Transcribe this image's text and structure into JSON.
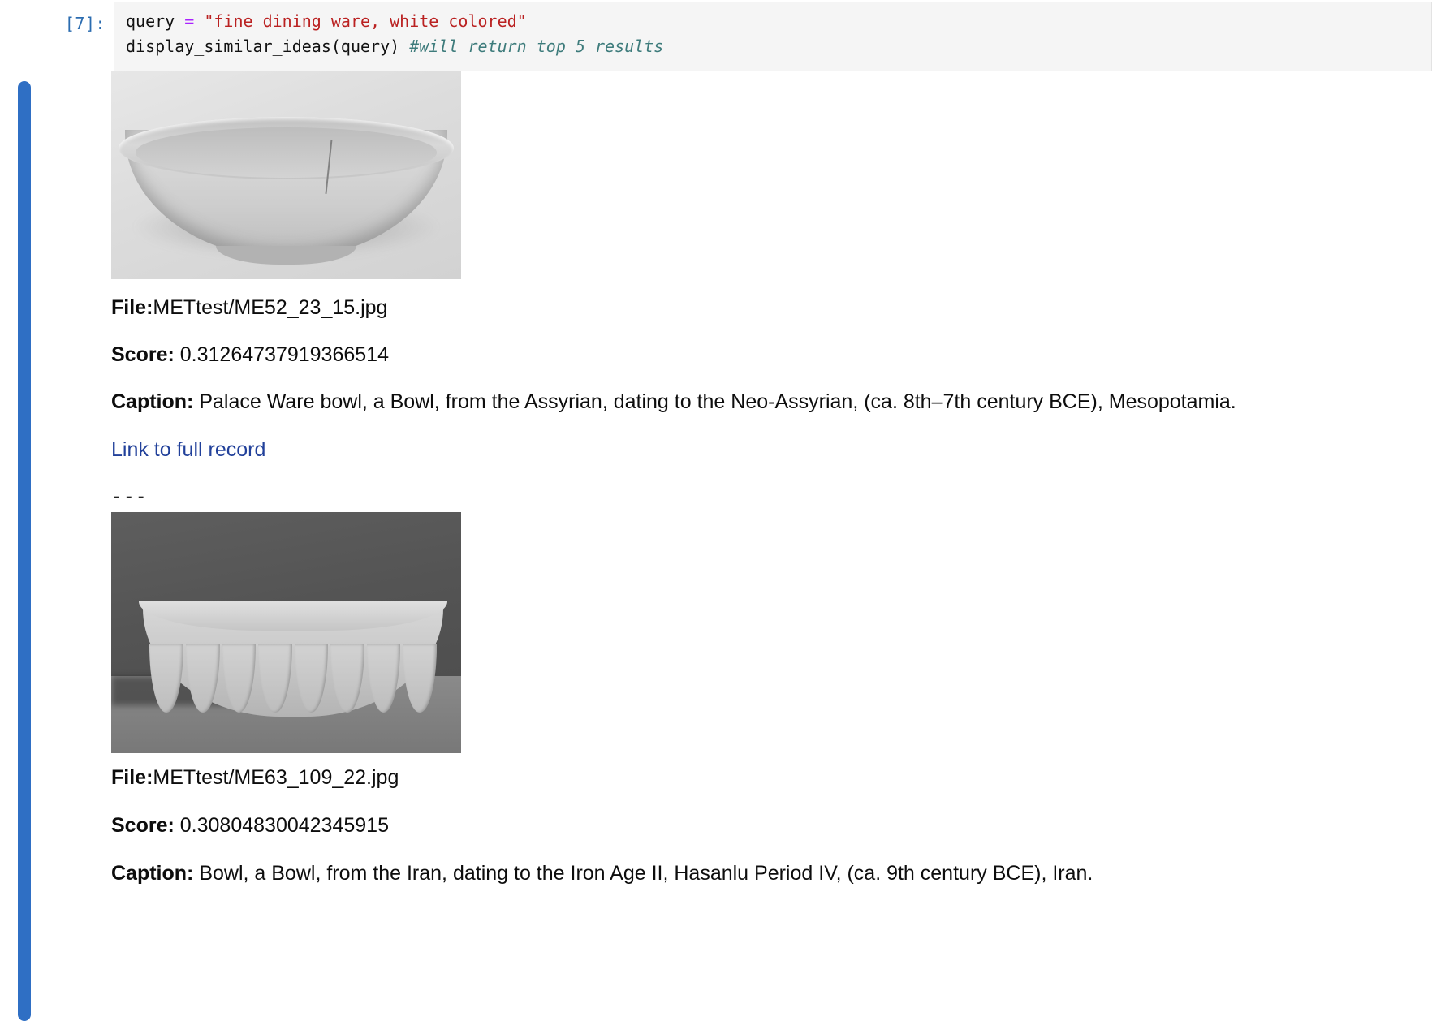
{
  "cell": {
    "prompt": "[7]:",
    "code": {
      "line1": {
        "var": "query ",
        "op": "=",
        "string": " \"fine dining ware, white colored\""
      },
      "line2": {
        "call": "display_similar_ideas(query) ",
        "comment": "#will return top 5 results"
      }
    }
  },
  "output": {
    "labels": {
      "file": "File:",
      "score": "Score:",
      "caption": "Caption:"
    },
    "separator": "---",
    "link_text": "Link to full record",
    "results": [
      {
        "image_alt": "grayscale-photo-shallow-palace-ware-bowl",
        "file": "METtest/ME52_23_15.jpg",
        "score": "0.31264737919366514",
        "caption": "Palace Ware bowl, a Bowl, from the Assyrian, dating to the Neo-Assyrian, (ca. 8th–7th century BCE), Mesopotamia."
      },
      {
        "image_alt": "grayscale-photo-fluted-stone-bowl",
        "file": "METtest/ME63_109_22.jpg",
        "score": "0.30804830042345915",
        "caption": "Bowl, a Bowl, from the Iran, dating to the Iron Age II, Hasanlu Period IV, (ca. 9th century BCE), Iran."
      }
    ]
  },
  "colors": {
    "selection_bar": "#2f6fc4",
    "prompt": "#2b6cb0",
    "string_token": "#ba2121",
    "operator_token": "#aa22ff",
    "comment_token": "#3d7b7b",
    "link": "#21409a",
    "code_background": "#f5f5f5"
  }
}
